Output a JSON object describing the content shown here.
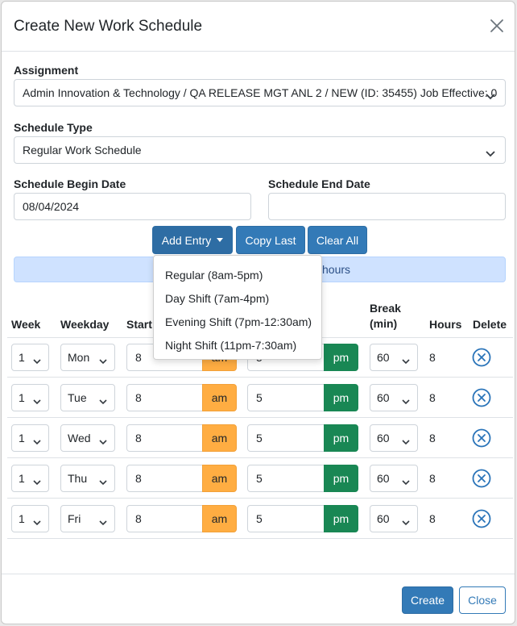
{
  "modal": {
    "title": "Create New Work Schedule"
  },
  "form": {
    "assignment_label": "Assignment",
    "assignment_value": "Admin Innovation & Technology / QA RELEASE MGT ANL 2 / NEW (ID: 35455) Job Effective: 0",
    "schedule_type_label": "Schedule Type",
    "schedule_type_value": "Regular Work Schedule",
    "begin_date_label": "Schedule Begin Date",
    "begin_date_value": "08/04/2024",
    "end_date_label": "Schedule End Date",
    "end_date_value": ""
  },
  "toolbar": {
    "add_entry_label": "Add Entry",
    "copy_last_label": "Copy Last",
    "clear_all_label": "Clear All"
  },
  "info_bar": {
    "text": "hours"
  },
  "add_entry_menu": [
    "Regular (8am-5pm)",
    "Day Shift (7am-4pm)",
    "Evening Shift (7pm-12:30am)",
    "Night Shift (11pm-7:30am)"
  ],
  "table": {
    "headers": {
      "week": "Week",
      "weekday": "Weekday",
      "start": "Start",
      "break_line1": "Break",
      "break_line2": "(min)",
      "hours": "Hours",
      "delete": "Delete"
    },
    "rows": [
      {
        "week": "1",
        "weekday": "Mon",
        "start": "8",
        "start_ampm": "am",
        "end": "5",
        "end_ampm": "pm",
        "break": "60",
        "hours": "8"
      },
      {
        "week": "1",
        "weekday": "Tue",
        "start": "8",
        "start_ampm": "am",
        "end": "5",
        "end_ampm": "pm",
        "break": "60",
        "hours": "8"
      },
      {
        "week": "1",
        "weekday": "Wed",
        "start": "8",
        "start_ampm": "am",
        "end": "5",
        "end_ampm": "pm",
        "break": "60",
        "hours": "8"
      },
      {
        "week": "1",
        "weekday": "Thu",
        "start": "8",
        "start_ampm": "am",
        "end": "5",
        "end_ampm": "pm",
        "break": "60",
        "hours": "8"
      },
      {
        "week": "1",
        "weekday": "Fri",
        "start": "8",
        "start_ampm": "am",
        "end": "5",
        "end_ampm": "pm",
        "break": "60",
        "hours": "8"
      }
    ]
  },
  "footer": {
    "create_label": "Create",
    "close_label": "Close"
  },
  "colors": {
    "primary": "#337ab7",
    "am": "#ffad42",
    "pm": "#198754",
    "info_bg": "#cfe2ff"
  },
  "icons": {
    "close": "close-icon",
    "chevron": "chevron-down-icon",
    "delete": "delete-circle-x-icon",
    "caret": "caret-down-icon"
  }
}
